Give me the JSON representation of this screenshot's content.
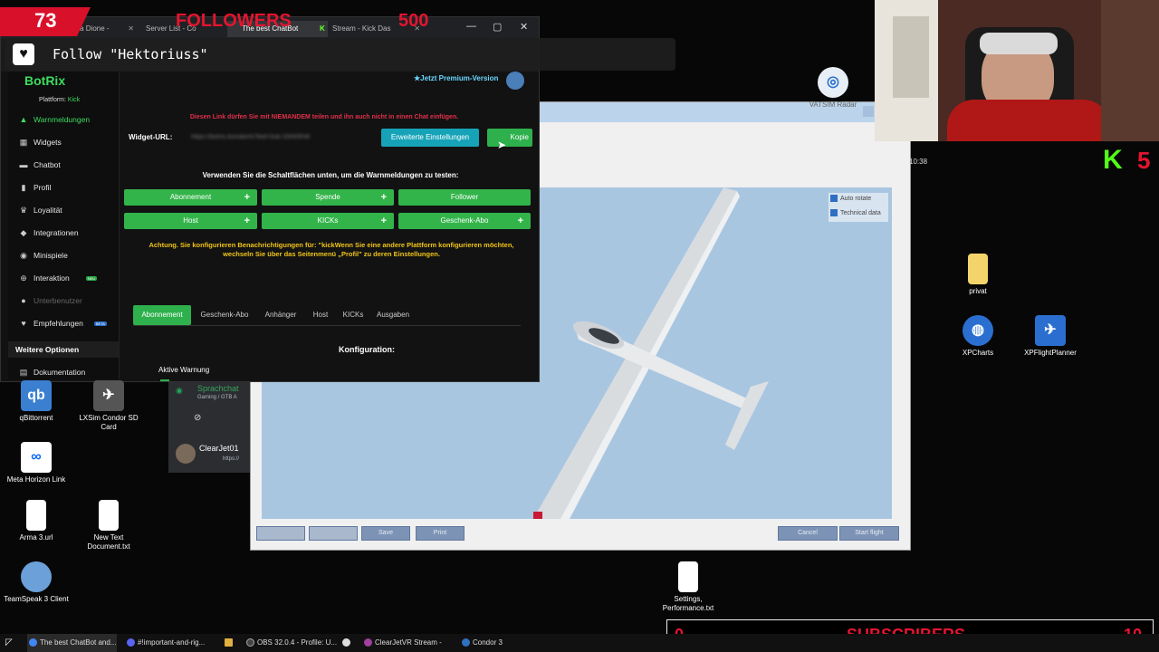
{
  "overlay": {
    "followers_count": "73",
    "followers_label": "FOLLOWERS",
    "followers_goal": "500",
    "follow_alert": "Follow \"Hektoriuss\"",
    "subscribers_count": "0",
    "subscribers_label": "SUBSCRIBERS",
    "subscribers_goal": "10",
    "kick_letter": "K",
    "kick_count": "5"
  },
  "browser": {
    "tabs": [
      {
        "label": "ura Dione -"
      },
      {
        "label": "Server List - Co"
      },
      {
        "label": "The best ChatBot"
      },
      {
        "label": "Stream - Kick Das"
      }
    ]
  },
  "botrix": {
    "logo": "BotRix",
    "platform_label": "Plattform:",
    "platform_value": "Kick",
    "premium": "Jetzt Premium-Version",
    "sidebar": [
      {
        "label": "Warnmeldungen",
        "icon": "warning-icon"
      },
      {
        "label": "Widgets",
        "icon": "widgets-icon"
      },
      {
        "label": "Chatbot",
        "icon": "chat-icon"
      },
      {
        "label": "Profil",
        "icon": "profile-icon"
      },
      {
        "label": "Loyalität",
        "icon": "trophy-icon"
      },
      {
        "label": "Integrationen",
        "icon": "puzzle-icon"
      },
      {
        "label": "Minispiele",
        "icon": "gamepad-icon"
      },
      {
        "label": "Interaktion",
        "icon": "interaction-icon",
        "badge": "NEU"
      },
      {
        "label": "Unterbenutzer",
        "icon": "users-icon"
      },
      {
        "label": "Empfehlungen",
        "icon": "recommend-icon",
        "badge": "BETA"
      }
    ],
    "more_options": "Weitere Optionen",
    "docs": "Dokumentation",
    "warning_text": "Diesen Link dürfen Sie mit NIEMANDEM teilen und ihn auch nicht in einen Chat einfügen.",
    "widget_url_label": "Widget-URL:",
    "widget_url_value": "https://botrix.live/alerts?bid=3ub-33rM3hW",
    "advanced_button": "Erweiterte Einstellungen",
    "copy_button": "Kopie",
    "test_hint": "Verwenden Sie die Schaltflächen unten, um die Warnmeldungen zu testen:",
    "test_buttons": [
      "Abonnement",
      "Spende",
      "Follower",
      "Host",
      "KICKs",
      "Geschenk-Abo"
    ],
    "attention_line1": "Achtung. Sie konfigurieren Benachrichtigungen für: \"kickWenn Sie eine andere Plattform konfigurieren möchten,",
    "attention_line2": "wechseln Sie über das Seitenmenü „Profil\" zu deren Einstellungen.",
    "type_tabs": [
      "Abonnement",
      "Geschenk-Abo",
      "Anhänger",
      "Host",
      "KICKs",
      "Ausgaben"
    ],
    "config_title": "Konfiguration:",
    "active_warning": "Aktive Warnung"
  },
  "desktop_icons": [
    {
      "label": "qBittorrent",
      "icon": "qbittorrent-icon"
    },
    {
      "label": "LXSim Condor SD Card",
      "icon": "plane-icon"
    },
    {
      "label": "Meta Horizon Link",
      "icon": "meta-icon"
    },
    {
      "label": "Arma 3.url",
      "icon": "file-icon"
    },
    {
      "label": "New Text Document.txt",
      "icon": "text-file-icon"
    },
    {
      "label": "TeamSpeak 3 Client",
      "icon": "teamspeak-icon"
    },
    {
      "label": "privat",
      "icon": "folder-icon"
    },
    {
      "label": "XPCharts",
      "icon": "globe-icon"
    },
    {
      "label": "XPFlightPlanner",
      "icon": "plane-icon"
    },
    {
      "label": "Settings, Performance.txt",
      "icon": "text-file-icon"
    },
    {
      "label": "VATSIM Radar",
      "icon": "radar-icon"
    }
  ],
  "discord": {
    "channel": "Sprachchat",
    "channel_sub": "Gaming / GTB A",
    "user": "ClearJet01",
    "user_sub": "https://"
  },
  "clock": "10:38",
  "condor": {
    "checkbox_rotate": "Auto rotate",
    "checkbox_technical": "Technical data",
    "buttons": [
      "",
      "",
      "Save",
      "Print",
      "Cancel",
      "Start flight"
    ]
  },
  "taskbar": [
    {
      "label": "The best ChatBot and...",
      "color": "#4285f4"
    },
    {
      "label": "#!important-and-rig...",
      "color": "#5865f2"
    },
    {
      "label": "",
      "color": "#e0b040"
    },
    {
      "label": "OBS 32.0.4 - Profile: U...",
      "color": "#444"
    },
    {
      "label": "",
      "color": "#ddd"
    },
    {
      "label": "ClearJetVR Stream -",
      "color": "#a040a0"
    },
    {
      "label": "Condor 3",
      "color": "#3070c0"
    }
  ]
}
